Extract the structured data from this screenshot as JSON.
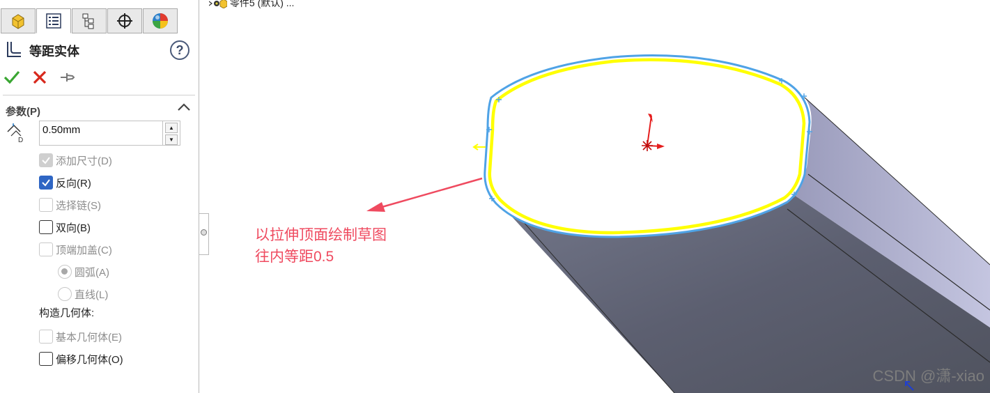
{
  "tabs": [
    {
      "name": "feature-manager",
      "icon": "feature-manager-icon"
    },
    {
      "name": "property-manager",
      "icon": "property-manager-icon",
      "active": true
    },
    {
      "name": "configuration-manager",
      "icon": "configuration-manager-icon"
    },
    {
      "name": "dimxpert-manager",
      "icon": "crosshair-icon"
    },
    {
      "name": "display-manager",
      "icon": "appearance-ball-icon"
    }
  ],
  "panel": {
    "title": "等距实体",
    "help": "?",
    "section_title": "参数(P)",
    "distance_value": "0.50mm",
    "spin_up": "▲",
    "spin_down": "▼",
    "checkboxes": {
      "add_dimension": {
        "label": "添加尺寸(D)",
        "checked": true,
        "disabled": true
      },
      "reverse": {
        "label": "反向(R)",
        "checked": true,
        "disabled": false
      },
      "select_chain": {
        "label": "选择链(S)",
        "checked": false,
        "disabled": true
      },
      "bidirectional": {
        "label": "双向(B)",
        "checked": false,
        "disabled": false
      },
      "cap_ends": {
        "label": "顶端加盖(C)",
        "checked": false,
        "disabled": true
      },
      "base_geometry": {
        "label": "基本几何体(E)",
        "checked": false,
        "disabled": true
      },
      "offset_geometry": {
        "label": "偏移几何体(O)",
        "checked": false,
        "disabled": false
      }
    },
    "radios": {
      "arc": {
        "label": "圆弧(A)",
        "selected": true
      },
      "line": {
        "label": "直线(L)",
        "selected": false
      }
    },
    "construction_label": "构造几何体:"
  },
  "viewport": {
    "tree_crumb": "零件5 (默认) ...",
    "annotation_line1": "以拉伸顶面绘制草图",
    "annotation_line2": "往内等距0.5",
    "watermark": "CSDN @潇-xiao",
    "colors": {
      "offset_curve": "#ffff00",
      "sketch_edge": "#4fa3e6",
      "annotation": "#ef4a5f",
      "body_side": "#5c5f70",
      "body_right": "#b2b3d0"
    }
  }
}
